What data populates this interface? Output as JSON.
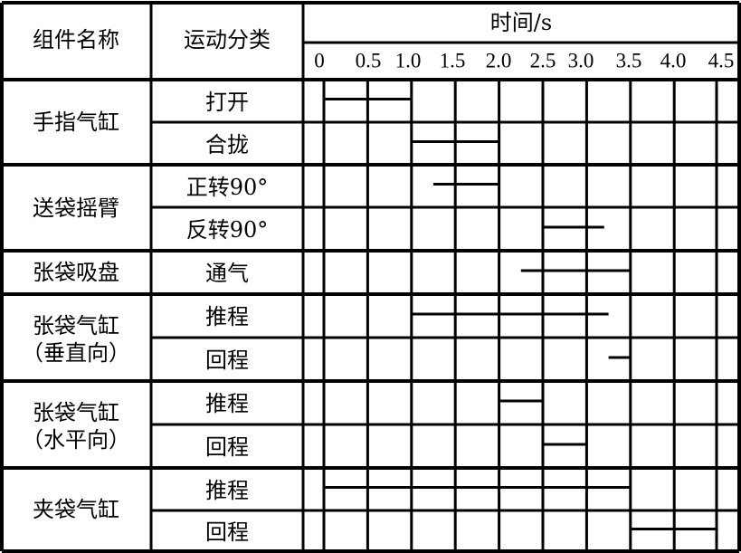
{
  "header": {
    "component_col": "组件名称",
    "motion_col": "运动分类",
    "time_col": "时间/s"
  },
  "chart_data": {
    "type": "gantt",
    "title": "时间/s",
    "xlabel": "时间/s",
    "xlim": [
      0,
      4.5
    ],
    "x_ticks": [
      "0",
      "0.5",
      "1.0",
      "1.5",
      "2.0",
      "2.5",
      "3.0",
      "3.5",
      "4.0",
      "4.5"
    ],
    "groups": [
      {
        "name": "手指气缸",
        "name_line2": "",
        "rows": [
          {
            "motion": "打开",
            "start": 0.0,
            "end": 1.0
          },
          {
            "motion": "合拢",
            "start": 1.0,
            "end": 2.0
          }
        ]
      },
      {
        "name": "送袋摇臂",
        "name_line2": "",
        "rows": [
          {
            "motion": "正转90°",
            "start": 1.25,
            "end": 2.0
          },
          {
            "motion": "反转90°",
            "start": 2.5,
            "end": 3.2
          }
        ]
      },
      {
        "name": "张袋吸盘",
        "name_line2": "",
        "rows": [
          {
            "motion": "通气",
            "start": 2.25,
            "end": 3.5
          }
        ]
      },
      {
        "name": "张袋气缸",
        "name_line2": "（垂直向）",
        "rows": [
          {
            "motion": "推程",
            "start": 1.0,
            "end": 3.25
          },
          {
            "motion": "回程",
            "start": 3.25,
            "end": 3.5
          }
        ]
      },
      {
        "name": "张袋气缸",
        "name_line2": "（水平向）",
        "rows": [
          {
            "motion": "推程",
            "start": 2.0,
            "end": 2.5
          },
          {
            "motion": "回程",
            "start": 2.5,
            "end": 3.0
          }
        ]
      },
      {
        "name": "夹袋气缸",
        "name_line2": "",
        "rows": [
          {
            "motion": "推程",
            "start": 0.0,
            "end": 3.5
          },
          {
            "motion": "回程",
            "start": 3.5,
            "end": 4.5
          }
        ]
      }
    ]
  }
}
